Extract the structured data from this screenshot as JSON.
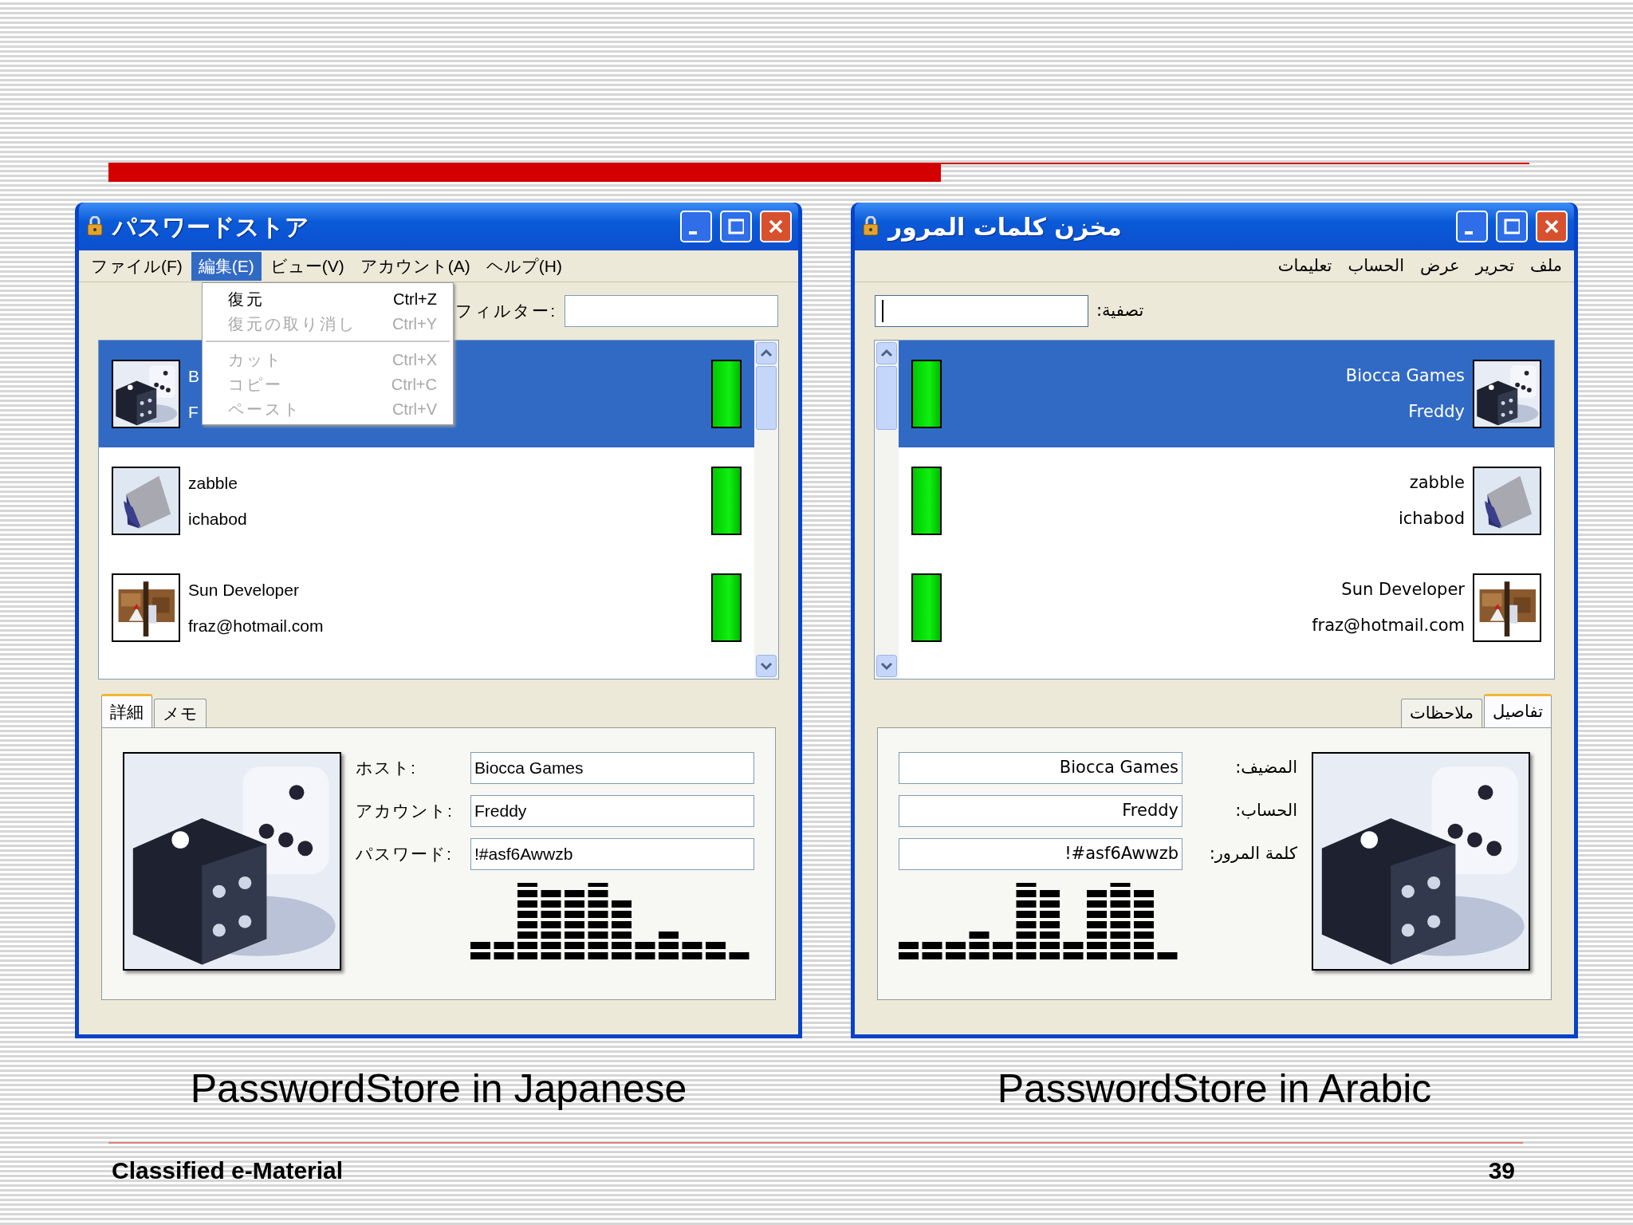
{
  "windows": [
    {
      "kind": "ltr",
      "title": "パスワードストア",
      "menu": [
        {
          "label": "ファイル(F)",
          "selected": false
        },
        {
          "label": "編集(E)",
          "selected": true
        },
        {
          "label": "ビュー(V)",
          "selected": false
        },
        {
          "label": "アカウント(A)",
          "selected": false
        },
        {
          "label": "ヘルプ(H)",
          "selected": false
        }
      ],
      "dropdown": [
        {
          "kind": "item",
          "label": "復元",
          "shortcut": "Ctrl+Z",
          "disabled": false
        },
        {
          "kind": "item",
          "label": "復元の取り消し",
          "shortcut": "Ctrl+Y",
          "disabled": true
        },
        {
          "kind": "separator"
        },
        {
          "kind": "item",
          "label": "カット",
          "shortcut": "Ctrl+X",
          "disabled": true
        },
        {
          "kind": "item",
          "label": "コピー",
          "shortcut": "Ctrl+C",
          "disabled": true
        },
        {
          "kind": "item",
          "label": "ペースト",
          "shortcut": "Ctrl+V",
          "disabled": true
        }
      ],
      "filter": {
        "label": "フィルター:",
        "focused": false
      },
      "entries": [
        {
          "host": "B",
          "account": "F",
          "selected": true
        },
        {
          "host": "zabble",
          "account": "ichabod",
          "selected": false
        },
        {
          "host": "Sun Developer",
          "account": "fraz@hotmail.com",
          "selected": false
        }
      ],
      "tabs": [
        {
          "label": "詳細",
          "selected": true
        },
        {
          "label": "メモ",
          "selected": false
        }
      ],
      "details": [
        {
          "label": "ホスト:",
          "value": "Biocca Games"
        },
        {
          "label": "アカウント:",
          "value": "Freddy"
        },
        {
          "label": "パスワード:",
          "value": "!#asf6Awwzb"
        }
      ],
      "caption": "PasswordStore in Japanese"
    },
    {
      "kind": "rtl",
      "title": "مخزن كلمات المرور",
      "menu": [
        {
          "label": "ملف",
          "selected": false
        },
        {
          "label": "تحرير",
          "selected": false
        },
        {
          "label": "عرض",
          "selected": false
        },
        {
          "label": "الحساب",
          "selected": false
        },
        {
          "label": "تعليمات",
          "selected": false
        }
      ],
      "filter": {
        "label": "تصفية:",
        "focused": true
      },
      "entries": [
        {
          "host": "Biocca Games",
          "account": "Freddy",
          "selected": true
        },
        {
          "host": "zabble",
          "account": "ichabod",
          "selected": false
        },
        {
          "host": "Sun Developer",
          "account": "fraz@hotmail.com",
          "selected": false
        }
      ],
      "tabs": [
        {
          "label": "تفاصيل",
          "selected": true
        },
        {
          "label": "ملاحظات",
          "selected": false
        }
      ],
      "details": [
        {
          "label": "المضيف:",
          "value": "Biocca Games"
        },
        {
          "label": "الحساب:",
          "value": "Freddy"
        },
        {
          "label": "كلمة المرور:",
          "value": "!#asf6Awwzb"
        }
      ],
      "caption": "PasswordStore in Arabic"
    }
  ],
  "footer": {
    "left": "Classified e-Material",
    "page": "39"
  }
}
